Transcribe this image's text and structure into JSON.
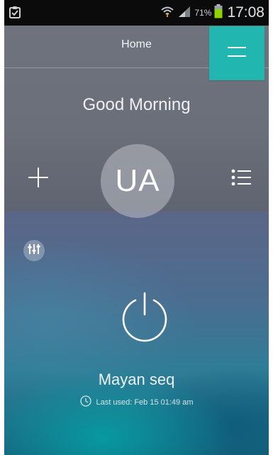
{
  "status_bar": {
    "battery_percent": "71%",
    "time": "17:08",
    "icons": [
      "clipboard-icon",
      "wifi-icon",
      "signal-icon",
      "battery-icon"
    ]
  },
  "app_bar": {
    "title": "Home",
    "menu_icon": "hamburger-icon"
  },
  "greeting": "Good Morning",
  "profile": {
    "initials": "UA"
  },
  "actions": {
    "add_icon": "plus-icon",
    "list_icon": "list-icon",
    "equalizer_icon": "equalizer-icon"
  },
  "scene": {
    "name": "Mayan seq",
    "last_used": "Last used: Feb 15 01:49 am",
    "power_icon": "power-icon"
  },
  "colors": {
    "accent": "#21b7b0",
    "status_bar_bg": "#0b0b0c",
    "battery_green": "#8fd400",
    "top_bg": "#6e737d"
  }
}
